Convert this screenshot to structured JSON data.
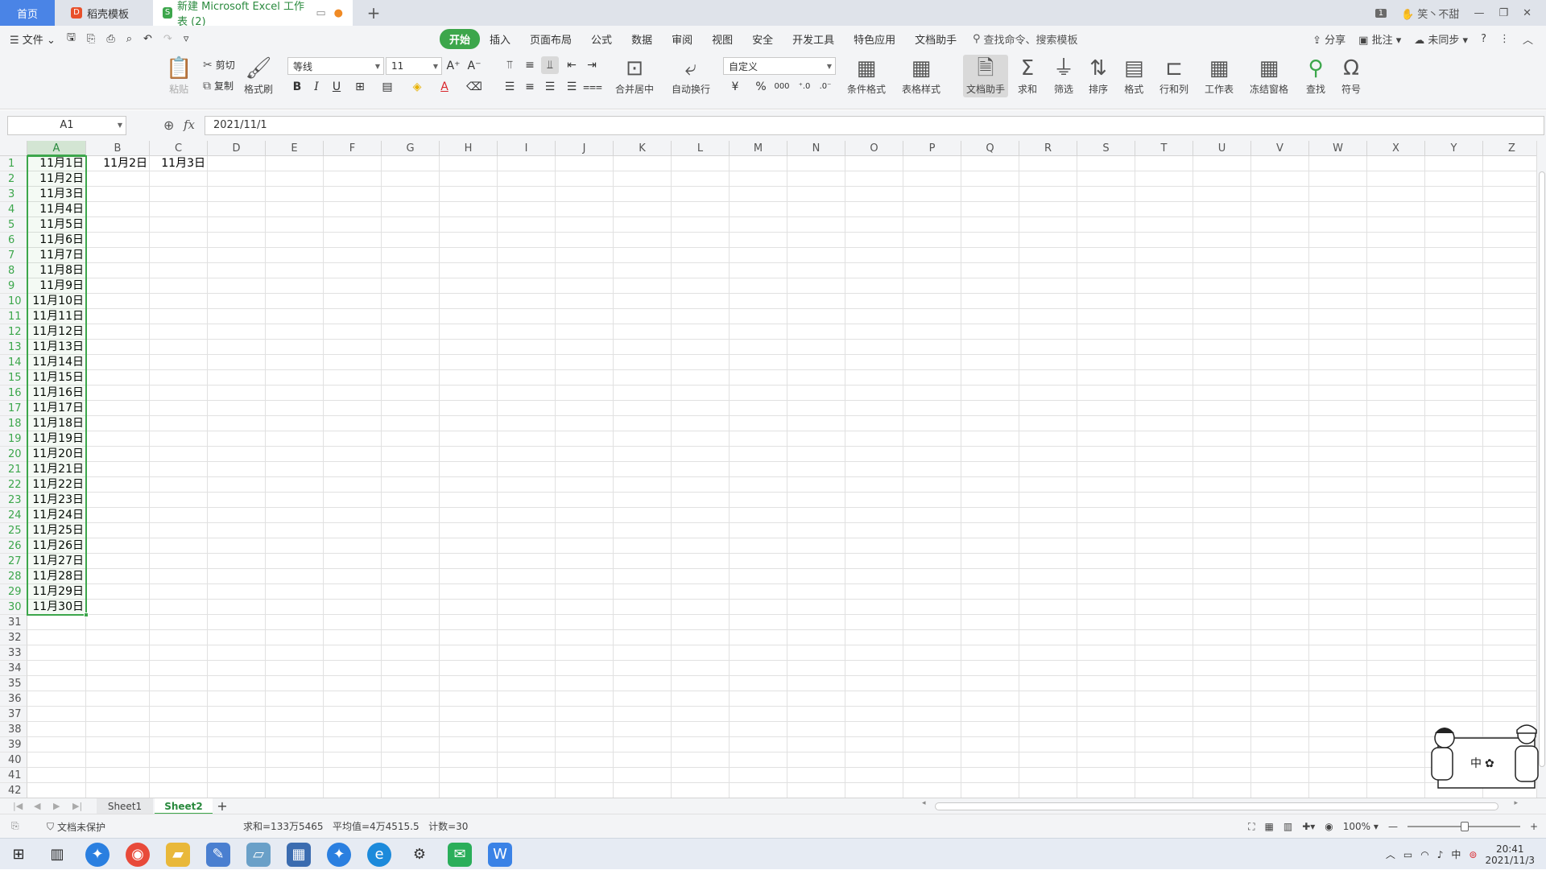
{
  "tabs": {
    "home": "首页",
    "template": "稻壳模板",
    "document": "新建 Microsoft Excel 工作表 (2)"
  },
  "window": {
    "badge": "1",
    "user": "笑丶不甜"
  },
  "menu": {
    "file": "文件",
    "tabs": [
      "开始",
      "插入",
      "页面布局",
      "公式",
      "数据",
      "审阅",
      "视图",
      "安全",
      "开发工具",
      "特色应用",
      "文档助手"
    ],
    "search": "查找命令、搜索模板",
    "share": "分享",
    "comment": "批注",
    "sync": "未同步"
  },
  "ribbon": {
    "paste": "粘贴",
    "cut": "剪切",
    "copy": "复制",
    "format_painter": "格式刷",
    "font_name": "等线",
    "font_size": "11",
    "merge_center": "合并居中",
    "wrap_text": "自动换行",
    "number_format": "自定义",
    "cond_format": "条件格式",
    "table_style": "表格样式",
    "doc_assistant": "文档助手",
    "sum": "求和",
    "filter": "筛选",
    "sort": "排序",
    "format": "格式",
    "rows_cols": "行和列",
    "worksheet": "工作表",
    "freeze": "冻结窗格",
    "find": "查找",
    "symbol": "符号"
  },
  "formula_bar": {
    "name_box": "A1",
    "fx": "fx",
    "value": "2021/11/1"
  },
  "grid": {
    "columns": [
      "A",
      "B",
      "C",
      "D",
      "E",
      "F",
      "G",
      "H",
      "I",
      "J",
      "K",
      "L",
      "M",
      "N",
      "O",
      "P",
      "Q",
      "R",
      "S",
      "T",
      "U",
      "V",
      "W",
      "X",
      "Y",
      "Z"
    ],
    "row_count": 42,
    "selected_column": "A",
    "column_a": [
      "11月1日",
      "11月2日",
      "11月3日",
      "11月4日",
      "11月5日",
      "11月6日",
      "11月7日",
      "11月8日",
      "11月9日",
      "11月10日",
      "11月11日",
      "11月12日",
      "11月13日",
      "11月14日",
      "11月15日",
      "11月16日",
      "11月17日",
      "11月18日",
      "11月19日",
      "11月20日",
      "11月21日",
      "11月22日",
      "11月23日",
      "11月24日",
      "11月25日",
      "11月26日",
      "11月27日",
      "11月28日",
      "11月29日",
      "11月30日"
    ],
    "b1": "11月2日",
    "c1": "11月3日"
  },
  "sheets": [
    "Sheet1",
    "Sheet2"
  ],
  "active_sheet": "Sheet2",
  "status": {
    "protect": "文档未保护",
    "stats": "求和=133万5465   平均值=4万4515.5   计数=30",
    "zoom": "100%"
  },
  "taskbar": {
    "time": "20:41",
    "date": "2021/11/3",
    "ime": "中"
  },
  "sticker_text": "中",
  "colors": {
    "accent_green": "#3ca64b",
    "home_tab_blue": "#4a84e6",
    "chrome_bg": "#f3f4f6"
  }
}
